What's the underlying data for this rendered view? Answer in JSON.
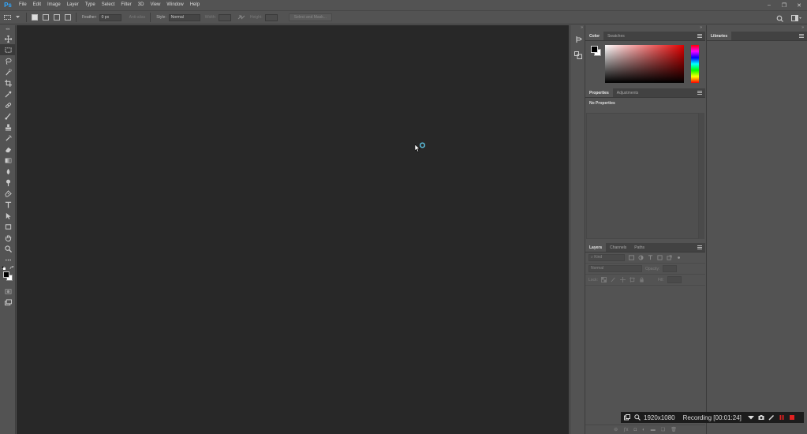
{
  "app": {
    "logo": "Ps"
  },
  "menu": [
    "File",
    "Edit",
    "Image",
    "Layer",
    "Type",
    "Select",
    "Filter",
    "3D",
    "View",
    "Window",
    "Help"
  ],
  "window_controls": {
    "minimize": "–",
    "restore": "❐",
    "close": "✕"
  },
  "options_bar": {
    "feather_label": "Feather:",
    "feather_value": "0 px",
    "anti_alias_label": "Anti-alias",
    "style_label": "Style:",
    "style_value": "Normal",
    "width_label": "Width:",
    "height_label": "Height:",
    "select_mask_label": "Select and Mask..."
  },
  "tools": [
    "move-tool",
    "marquee-tool",
    "lasso-tool",
    "quick-selection-tool",
    "crop-tool",
    "eyedropper-tool",
    "healing-brush-tool",
    "brush-tool",
    "clone-stamp-tool",
    "history-brush-tool",
    "eraser-tool",
    "gradient-tool",
    "blur-tool",
    "dodge-tool",
    "pen-tool",
    "type-tool",
    "path-selection-tool",
    "rectangle-tool",
    "hand-tool",
    "zoom-tool",
    "more-tools"
  ],
  "color_panel": {
    "tabs": [
      "Color",
      "Swatches"
    ],
    "foreground": "#000000",
    "background": "#ffffff",
    "hue_color": "#e00000"
  },
  "properties_panel": {
    "tabs": [
      "Properties",
      "Adjustments"
    ],
    "empty_message": "No Properties"
  },
  "layers_panel": {
    "tabs": [
      "Layers",
      "Channels",
      "Paths"
    ],
    "filter_placeholder": "Kind",
    "blend_mode": "Normal",
    "opacity_label": "Opacity:",
    "lock_label": "Lock:",
    "fill_label": "Fill:"
  },
  "libraries_panel": {
    "tab": "Libraries"
  },
  "recording": {
    "resolution": "1920x1080",
    "status": "Recording [00:01:24]"
  }
}
